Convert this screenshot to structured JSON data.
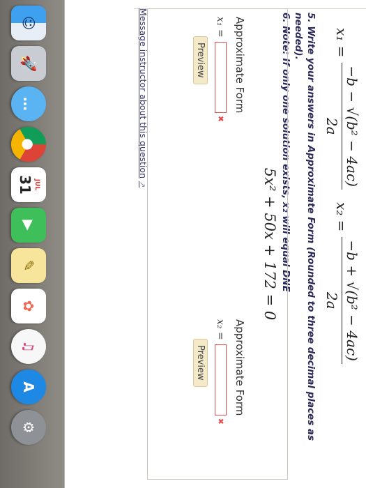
{
  "formulas": {
    "x1_label": "x₁ =",
    "x1_numerator": "−b − √(b² − 4ac)",
    "x1_denominator": "2a",
    "x2_label": "x₂ =",
    "x2_numerator": "−b + √(b² − 4ac)",
    "x2_denominator": "2a"
  },
  "instructions": {
    "step5": "5. Write your answers in Approximate Form (Rounded to three decimal places as needed).",
    "step6": "6. Note: If only one solution exists, x₂ will equal DNE"
  },
  "equation": "5x² + 50x + 172 = 0",
  "answers": {
    "x1": {
      "title": "Approximate Form",
      "label": "x₁ =",
      "value": "",
      "preview_label": "Preview"
    },
    "x2": {
      "title": "Approximate Form",
      "label": "x₂ =",
      "value": "",
      "preview_label": "Preview"
    }
  },
  "message_link": "Message instructor about this question",
  "dock": {
    "calendar_month": "JUL",
    "calendar_day": "31",
    "icons": [
      "finder-icon",
      "launchpad-icon",
      "messages-icon",
      "chrome-icon",
      "calendar-icon",
      "facetime-icon",
      "notes-icon",
      "photos-icon",
      "itunes-icon",
      "app-store-icon",
      "system-preferences-icon"
    ]
  }
}
